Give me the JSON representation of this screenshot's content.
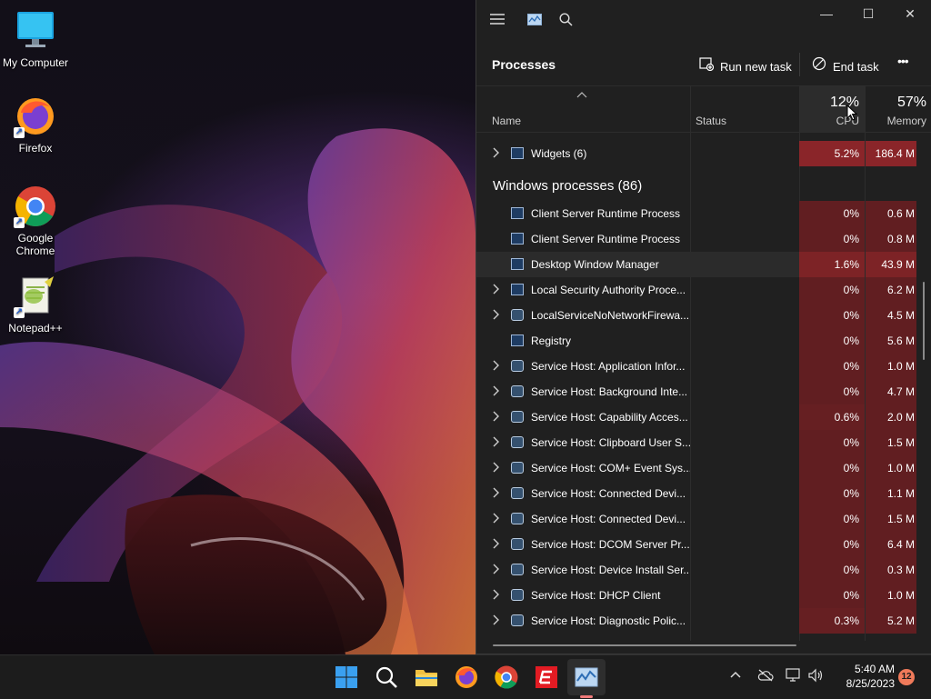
{
  "desktop": {
    "icons": [
      {
        "label": "My Computer",
        "icon": "monitor-icon"
      },
      {
        "label": "Firefox",
        "icon": "firefox-icon"
      },
      {
        "label": "Google Chrome",
        "icon": "chrome-icon"
      },
      {
        "label": "Notepad++",
        "icon": "notepadpp-icon"
      }
    ]
  },
  "taskmanager": {
    "header": {
      "menu_icon": "hamburger-icon",
      "app_icon": "taskmanager-icon",
      "search_icon": "search-icon"
    },
    "window_controls": {
      "minimize": "—",
      "maximize": "☐",
      "close": "✕"
    },
    "page_title": "Processes",
    "toolbar": {
      "run_new_task": "Run new task",
      "end_task": "End task",
      "more": "•••"
    },
    "columns": {
      "name": "Name",
      "status": "Status",
      "cpu_total": "12%",
      "cpu_label": "CPU",
      "memory_total": "57%",
      "memory_label": "Memory"
    },
    "rows": [
      {
        "kind": "app",
        "expandable": true,
        "name": "Widgets (6)",
        "cpu": "5.2%",
        "memory": "186.4 M",
        "cpu_heat": 0.7,
        "mem_heat": 0.7
      },
      {
        "kind": "group",
        "name": "Windows processes (86)"
      },
      {
        "kind": "app",
        "expandable": false,
        "name": "Client Server Runtime Process",
        "cpu": "0%",
        "memory": "0.6 M",
        "cpu_heat": 0.25,
        "mem_heat": 0.25
      },
      {
        "kind": "app",
        "expandable": false,
        "name": "Client Server Runtime Process",
        "cpu": "0%",
        "memory": "0.8 M",
        "cpu_heat": 0.25,
        "mem_heat": 0.25
      },
      {
        "kind": "app",
        "expandable": false,
        "name": "Desktop Window Manager",
        "cpu": "1.6%",
        "memory": "43.9 M",
        "cpu_heat": 0.55,
        "mem_heat": 0.55,
        "selected": true
      },
      {
        "kind": "app",
        "expandable": true,
        "name": "Local Security Authority Proce...",
        "cpu": "0%",
        "memory": "6.2 M",
        "cpu_heat": 0.25,
        "mem_heat": 0.25
      },
      {
        "kind": "svc",
        "expandable": true,
        "name": "LocalServiceNoNetworkFirewa...",
        "cpu": "0%",
        "memory": "4.5 M",
        "cpu_heat": 0.25,
        "mem_heat": 0.25
      },
      {
        "kind": "app",
        "expandable": false,
        "name": "Registry",
        "cpu": "0%",
        "memory": "5.6 M",
        "cpu_heat": 0.25,
        "mem_heat": 0.25
      },
      {
        "kind": "svc",
        "expandable": true,
        "name": "Service Host: Application Infor...",
        "cpu": "0%",
        "memory": "1.0 M",
        "cpu_heat": 0.25,
        "mem_heat": 0.25
      },
      {
        "kind": "svc",
        "expandable": true,
        "name": "Service Host: Background Inte...",
        "cpu": "0%",
        "memory": "4.7 M",
        "cpu_heat": 0.25,
        "mem_heat": 0.25
      },
      {
        "kind": "svc",
        "expandable": true,
        "name": "Service Host: Capability Acces...",
        "cpu": "0.6%",
        "memory": "2.0 M",
        "cpu_heat": 0.3,
        "mem_heat": 0.25
      },
      {
        "kind": "svc",
        "expandable": true,
        "name": "Service Host: Clipboard User S...",
        "cpu": "0%",
        "memory": "1.5 M",
        "cpu_heat": 0.25,
        "mem_heat": 0.25
      },
      {
        "kind": "svc",
        "expandable": true,
        "name": "Service Host: COM+ Event Sys...",
        "cpu": "0%",
        "memory": "1.0 M",
        "cpu_heat": 0.25,
        "mem_heat": 0.25
      },
      {
        "kind": "svc",
        "expandable": true,
        "name": "Service Host: Connected Devi...",
        "cpu": "0%",
        "memory": "1.1 M",
        "cpu_heat": 0.25,
        "mem_heat": 0.25
      },
      {
        "kind": "svc",
        "expandable": true,
        "name": "Service Host: Connected Devi...",
        "cpu": "0%",
        "memory": "1.5 M",
        "cpu_heat": 0.25,
        "mem_heat": 0.25
      },
      {
        "kind": "svc",
        "expandable": true,
        "name": "Service Host: DCOM Server Pr...",
        "cpu": "0%",
        "memory": "6.4 M",
        "cpu_heat": 0.25,
        "mem_heat": 0.25
      },
      {
        "kind": "svc",
        "expandable": true,
        "name": "Service Host: Device Install Ser...",
        "cpu": "0%",
        "memory": "0.3 M",
        "cpu_heat": 0.25,
        "mem_heat": 0.25
      },
      {
        "kind": "svc",
        "expandable": true,
        "name": "Service Host: DHCP Client",
        "cpu": "0%",
        "memory": "1.0 M",
        "cpu_heat": 0.25,
        "mem_heat": 0.25
      },
      {
        "kind": "svc",
        "expandable": true,
        "name": "Service Host: Diagnostic Polic...",
        "cpu": "0.3%",
        "memory": "5.2 M",
        "cpu_heat": 0.3,
        "mem_heat": 0.25
      }
    ],
    "colors": {
      "heat_low": "#4a1a1c",
      "heat_high": "#a62a2f",
      "selected_row": "#2b2b2b"
    }
  },
  "taskbar": {
    "pinned": [
      {
        "icon": "windows-start-icon"
      },
      {
        "icon": "search-icon"
      },
      {
        "icon": "file-explorer-icon"
      },
      {
        "icon": "firefox-icon"
      },
      {
        "icon": "chrome-icon"
      },
      {
        "icon": "app-red-e-icon"
      },
      {
        "icon": "taskmanager-icon",
        "active": true
      }
    ],
    "tray": {
      "chevron": "^",
      "time": "5:40 AM",
      "date": "8/25/2023",
      "notification_count": "12"
    }
  }
}
